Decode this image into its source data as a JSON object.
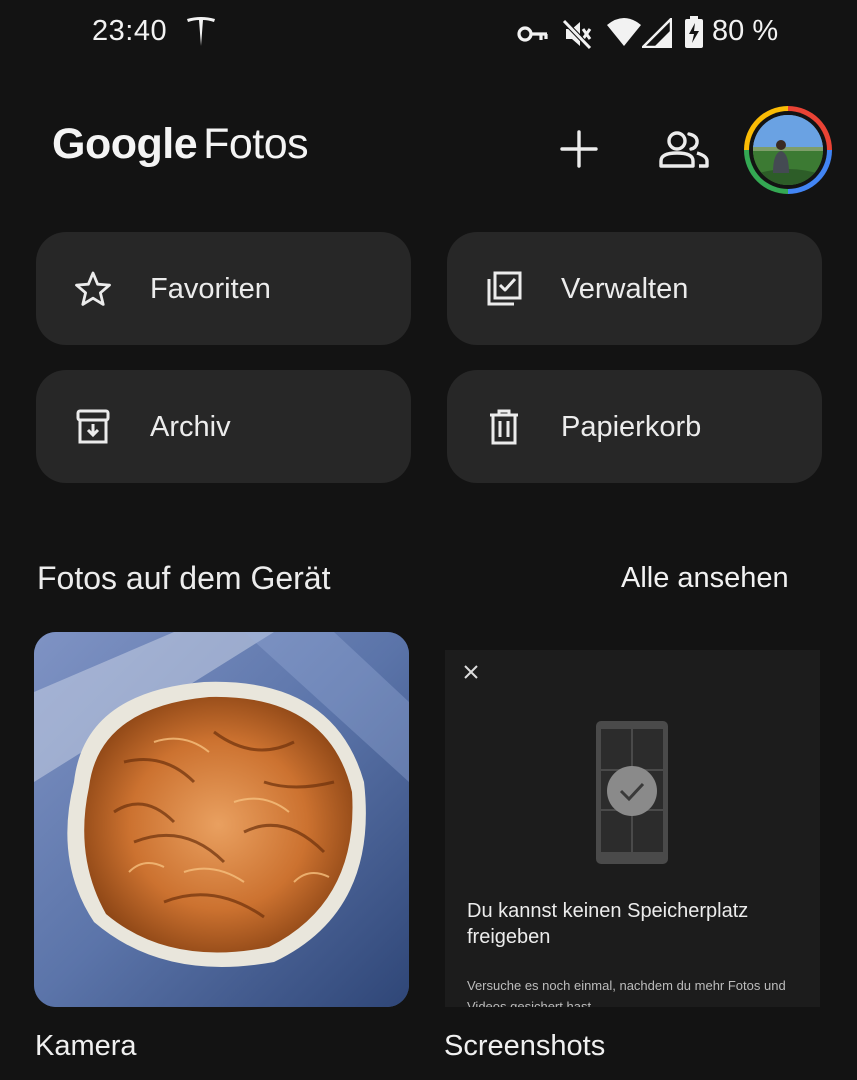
{
  "status_bar": {
    "time": "23:40",
    "battery_percent": "80 %",
    "icons": [
      "tesla-icon",
      "vpn-key-icon",
      "mute-icon",
      "wifi-icon",
      "signal-icon",
      "battery-charging-icon"
    ]
  },
  "header": {
    "logo_google": "Google",
    "logo_fotos": "Fotos",
    "add_icon": "plus-icon",
    "sharing_icon": "people-icon",
    "avatar": "profile-avatar"
  },
  "quick_actions": [
    {
      "label": "Favoriten",
      "icon": "star-icon"
    },
    {
      "label": "Verwalten",
      "icon": "manage-icon"
    },
    {
      "label": "Archiv",
      "icon": "archive-icon"
    },
    {
      "label": "Papierkorb",
      "icon": "trash-icon"
    }
  ],
  "section": {
    "title": "Fotos auf dem Gerät",
    "link": "Alle ansehen"
  },
  "albums": [
    {
      "label": "Kamera"
    },
    {
      "label": "Screenshots"
    }
  ],
  "free_up_card": {
    "title": "Du kannst keinen Speicherplatz freigeben",
    "text": "Versuche es noch einmal, nachdem du mehr Fotos und Videos gesichert hast."
  },
  "colors": {
    "background": "#131313",
    "chip": "#272727",
    "card": "#1c1c1c",
    "text": "#ececec"
  }
}
